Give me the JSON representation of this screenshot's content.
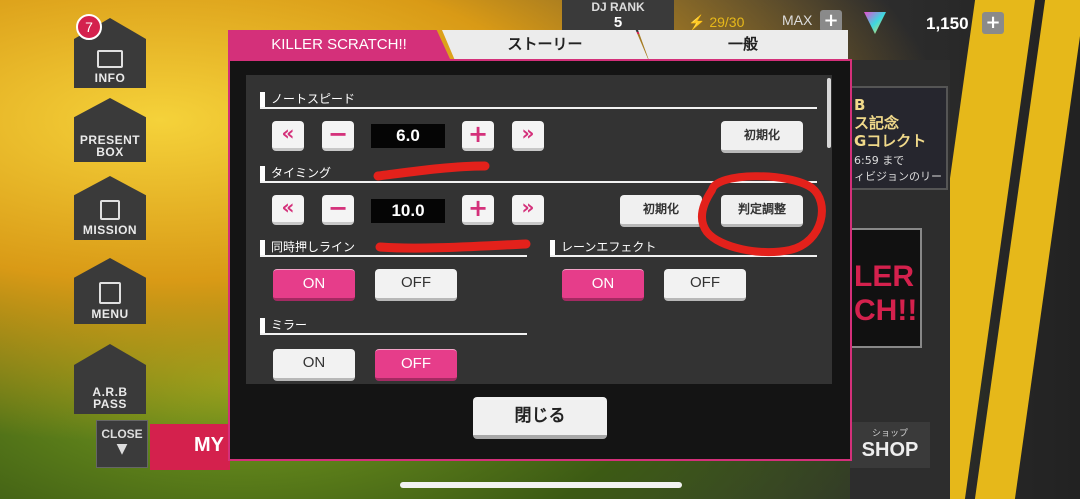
{
  "colors": {
    "accent": "#d4307a",
    "on": "#e63d8a",
    "annotation": "#e3211b"
  },
  "background": {
    "side_menu": [
      {
        "label": "INFO",
        "icon": "mail-icon"
      },
      {
        "label": "PRESENT\nBOX",
        "icon": "gift-icon"
      },
      {
        "label": "MISSION",
        "icon": "checklist-icon"
      },
      {
        "label": "MENU",
        "icon": "grid-icon"
      },
      {
        "label": "A.R.B\nPASS",
        "icon": "pass-icon"
      }
    ],
    "info_badge": "7",
    "close_label": "CLOSE",
    "my_label": "MY",
    "dj_rank_label": "DJ RANK",
    "dj_rank_value": "5",
    "stamina": "29/30",
    "max_label": "MAX",
    "gem_count": "1,150",
    "event_card": {
      "title": "B\nス記念\nGコレクト",
      "time": "6:59 まで",
      "subtitle": "ィビジョンのリー"
    },
    "event_card2": "LER\nCH!!",
    "shop_small": "ショップ",
    "shop_label": "SHOP"
  },
  "tabs": [
    {
      "label": "KILLER SCRATCH!!",
      "active": true
    },
    {
      "label": "ストーリー",
      "active": false
    },
    {
      "label": "一般",
      "active": false
    }
  ],
  "settings": {
    "note_speed": {
      "title": "ノートスピード",
      "value": "6.0",
      "reset_label": "初期化",
      "decrease_fast": "«",
      "decrease": "−",
      "increase": "+",
      "increase_fast": "»"
    },
    "timing": {
      "title": "タイミング",
      "value": "10.0",
      "reset_label": "初期化",
      "judge_label": "判定調整",
      "decrease_fast": "«",
      "decrease": "−",
      "increase": "+",
      "increase_fast": "»"
    },
    "simultaneous_line": {
      "title": "同時押しライン",
      "on": "ON",
      "off": "OFF",
      "selected": "ON"
    },
    "lane_effect": {
      "title": "レーンエフェクト",
      "on": "ON",
      "off": "OFF",
      "selected": "ON"
    },
    "mirror": {
      "title": "ミラー",
      "on": "ON",
      "off": "OFF",
      "selected": "OFF"
    }
  },
  "close_button": "閉じる"
}
